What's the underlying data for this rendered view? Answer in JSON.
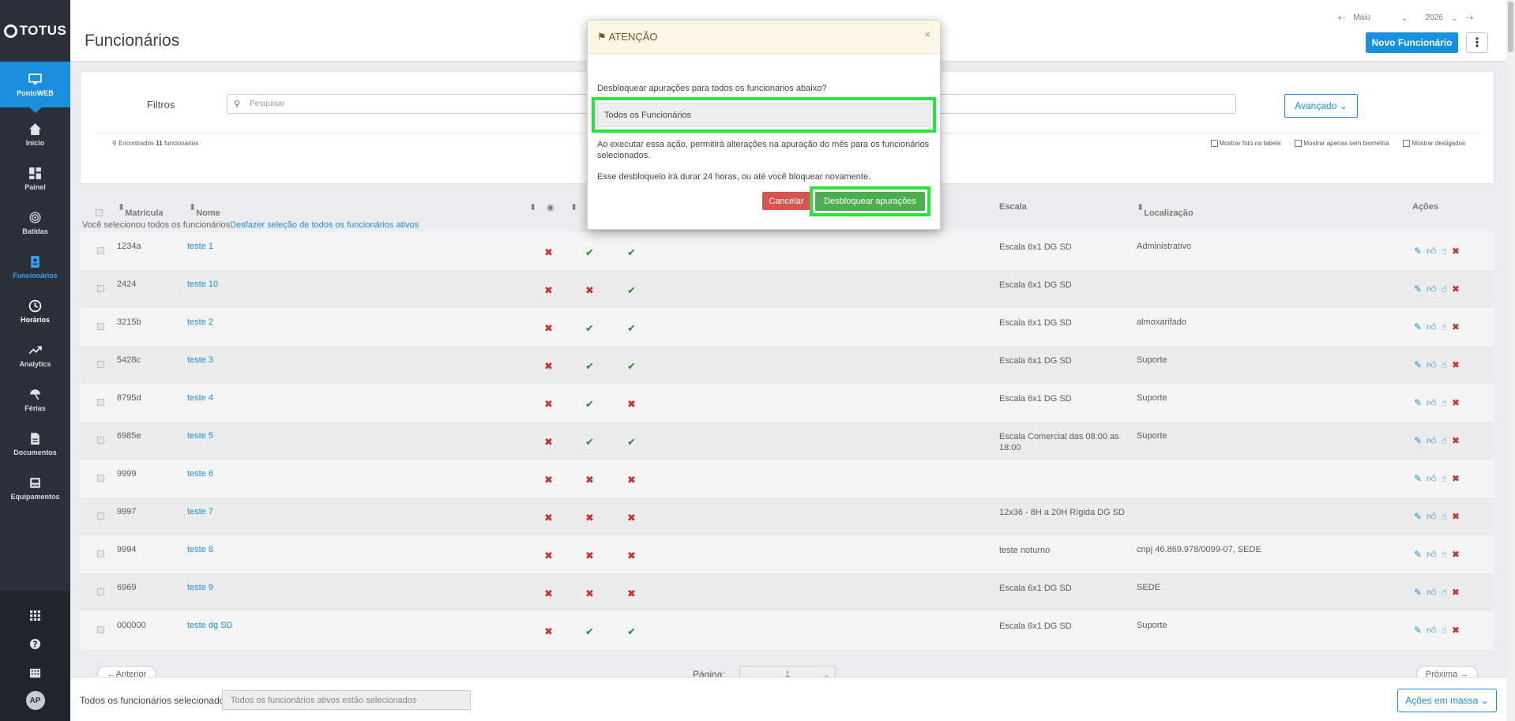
{
  "app": {
    "logo": "TOTUS",
    "page_title": "Funcionários",
    "month": "Maio",
    "year": "2026",
    "new_button": "Novo Funcionário"
  },
  "sidebar": {
    "items": [
      {
        "label": "PontoWEB",
        "icon": "monitor-icon"
      },
      {
        "label": "Início",
        "icon": "home-icon"
      },
      {
        "label": "Painel",
        "icon": "dashboard-icon"
      },
      {
        "label": "Batidas",
        "icon": "fingerprint-icon"
      },
      {
        "label": "Funcionários",
        "icon": "badge-icon"
      },
      {
        "label": "Horários",
        "icon": "clock-icon"
      },
      {
        "label": "Analytics",
        "icon": "trend-icon"
      },
      {
        "label": "Férias",
        "icon": "umbrella-icon"
      },
      {
        "label": "Documentos",
        "icon": "document-icon"
      },
      {
        "label": "Equipamentos",
        "icon": "device-icon"
      }
    ],
    "avatar": "AP"
  },
  "filters": {
    "label": "Filtros",
    "search_placeholder": "Pesquisar",
    "advanced": "Avançado",
    "found_prefix": "Encontrados",
    "found_count": "11",
    "found_suffix": "funcionários",
    "show_photo": "Mostrar foto na tabela",
    "show_no_bio": "Mostrar apenas sem biometria",
    "show_dismissed": "Mostrar desligados"
  },
  "table": {
    "headers": {
      "matricula": "Matrícula",
      "nome": "Nome",
      "escala": "Escala",
      "localizacao": "Localização",
      "acoes": "Ações"
    },
    "selection_text": "Você selecionou todos os funcionários",
    "selection_link": "Desfazer seleção de todos os funcionários ativos",
    "rows": [
      {
        "matricula": "1234a",
        "nome": "teste 1",
        "c1": "x",
        "c2": "ok",
        "c3": "ok",
        "escala": "Escala 6x1 DG SD",
        "local": "Administrativo"
      },
      {
        "matricula": "2424",
        "nome": "teste 10",
        "c1": "x",
        "c2": "x",
        "c3": "ok",
        "escala": "Escala 6x1 DG SD",
        "local": ""
      },
      {
        "matricula": "3215b",
        "nome": "teste 2",
        "c1": "x",
        "c2": "ok",
        "c3": "ok",
        "escala": "Escala 6x1 DG SD",
        "local": "almoxarifado"
      },
      {
        "matricula": "5428c",
        "nome": "teste 3",
        "c1": "x",
        "c2": "ok",
        "c3": "ok",
        "escala": "Escala 6x1 DG SD",
        "local": "Suporte"
      },
      {
        "matricula": "8795d",
        "nome": "teste 4",
        "c1": "x",
        "c2": "ok",
        "c3": "x",
        "escala": "Escala 6x1 DG SD",
        "local": "Suporte"
      },
      {
        "matricula": "6985e",
        "nome": "teste 5",
        "c1": "x",
        "c2": "ok",
        "c3": "ok",
        "escala": "Escala Comercial das 08:00 as 18:00",
        "local": "Suporte"
      },
      {
        "matricula": "9999",
        "nome": "teste 6",
        "c1": "x",
        "c2": "x",
        "c3": "x",
        "escala": "",
        "local": ""
      },
      {
        "matricula": "9997",
        "nome": "teste 7",
        "c1": "x",
        "c2": "x",
        "c3": "x",
        "escala": "12x36 - 8H a 20H Rígida DG SD",
        "local": ""
      },
      {
        "matricula": "9994",
        "nome": "teste 8",
        "c1": "x",
        "c2": "x",
        "c3": "x",
        "escala": "teste noturno",
        "local": "cnpj 46.869.978/0099-07, SEDE"
      },
      {
        "matricula": "6969",
        "nome": "teste 9",
        "c1": "x",
        "c2": "x",
        "c3": "x",
        "escala": "Escala 6x1 DG SD",
        "local": "SEDE"
      },
      {
        "matricula": "000000",
        "nome": "teste dg SD",
        "c1": "x",
        "c2": "ok",
        "c3": "ok",
        "escala": "Escala 6x1 DG SD",
        "local": "Suporte"
      }
    ]
  },
  "pager": {
    "prev": "←Anterior",
    "label": "Página:",
    "page": "1",
    "next": "Próxima →"
  },
  "bottom": {
    "label": "Todos os funcionários selecionados",
    "value": "Todos os funcionários ativos estão selecionados",
    "mass_actions": "Ações em massa"
  },
  "modal": {
    "title": "ATENÇÃO",
    "close": "×",
    "question": "Desbloquear apurações para todos os funcionarios abaixo?",
    "selection": "Todos os Funcionários",
    "paragraph1": "Ao executar essa ação, permitirá alterações na apuração do mês para os funcionários selecionados.",
    "paragraph2": "Esse desbloqueio irá durar 24 horas, ou até você bloquear novamente.",
    "cancel": "Cancelar",
    "confirm": "Desbloquear apurações"
  },
  "colors": {
    "accent": "#1a8fde",
    "sidebar": "#2a2f3a",
    "danger": "#d9534f",
    "success": "#4cae4c",
    "highlight": "#25e63d"
  }
}
